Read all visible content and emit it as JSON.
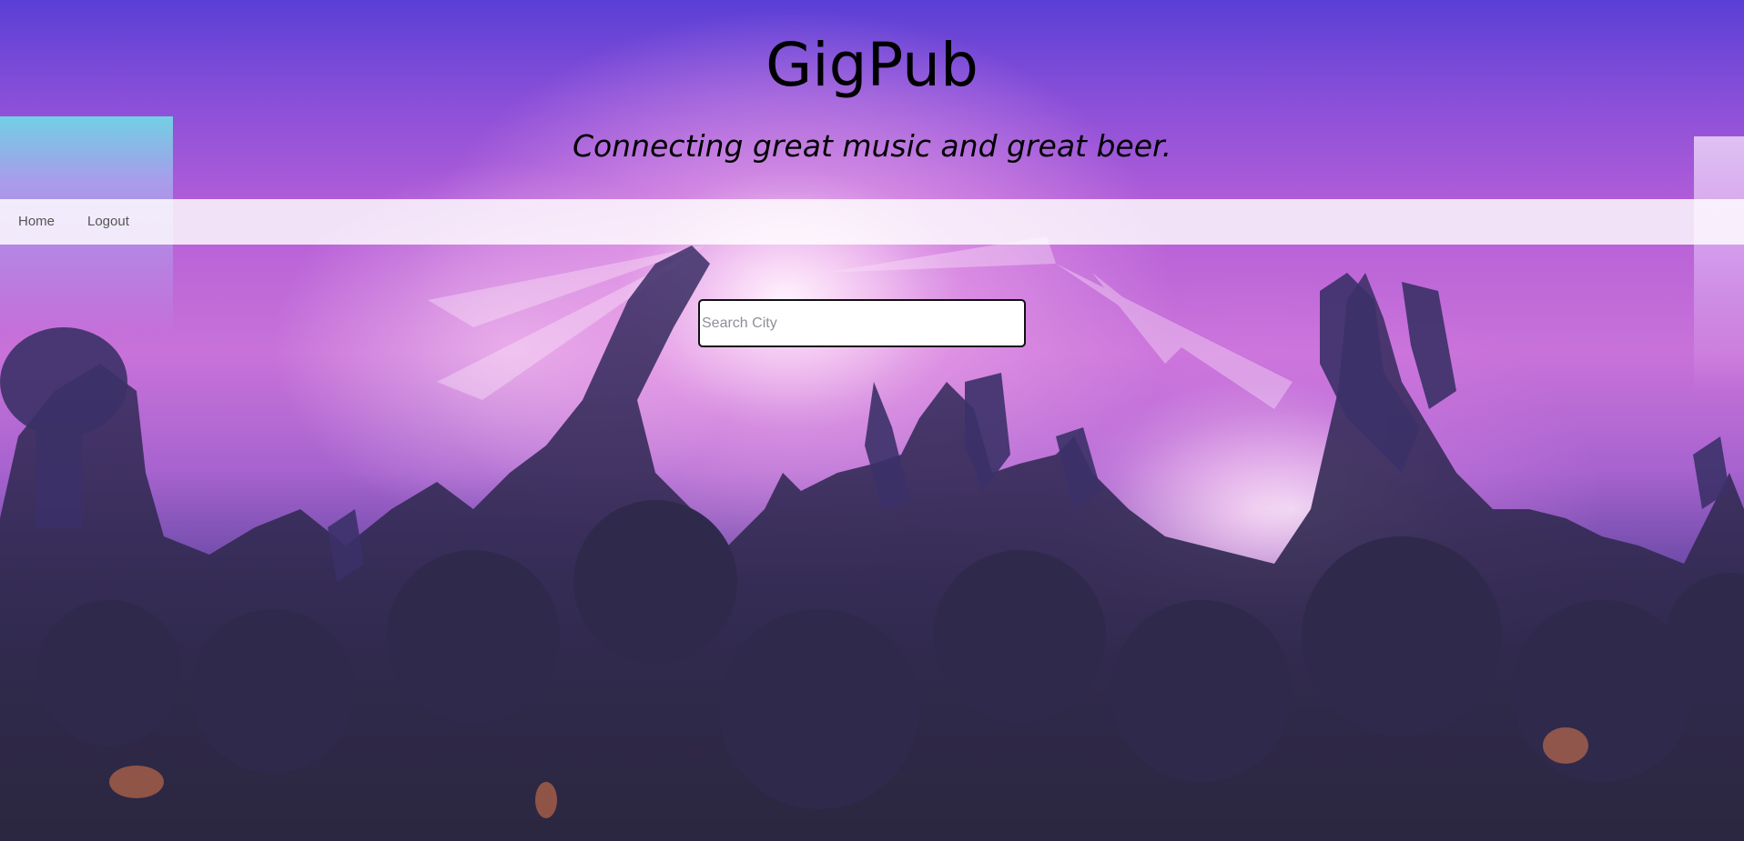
{
  "header": {
    "title": "GigPub",
    "tagline": "Connecting great music and great beer."
  },
  "nav": {
    "items": [
      {
        "label": "Home"
      },
      {
        "label": "Logout"
      }
    ]
  },
  "search": {
    "placeholder": "Search City",
    "value": ""
  },
  "background": {
    "description_icon": "concert-crowd-image",
    "accent": "#b65fd8"
  }
}
